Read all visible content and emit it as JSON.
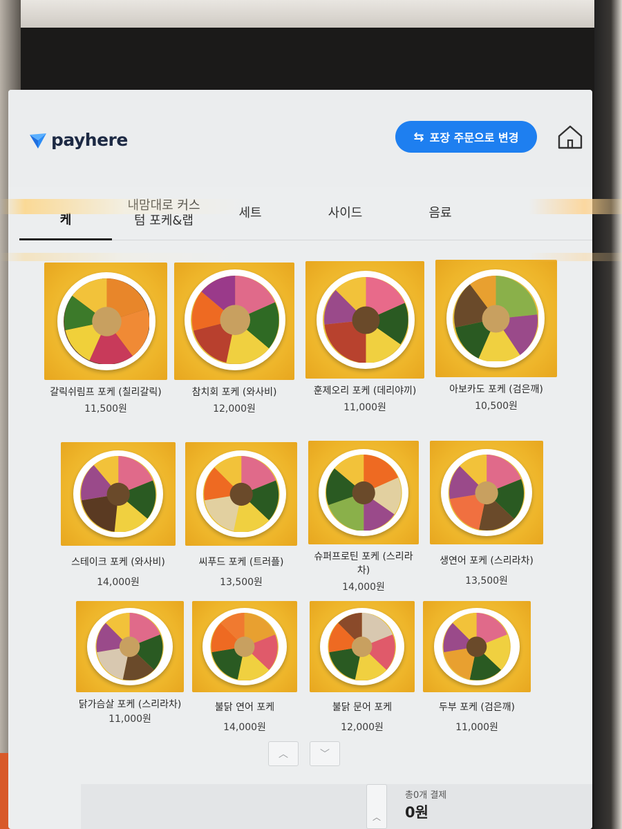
{
  "header": {
    "brand": "payhere",
    "takeout_label": "포장 주문으로 변경"
  },
  "tabs": [
    {
      "label": "케",
      "active": true
    },
    {
      "label": "내맘대로 커스텀 포케&랩",
      "active": false
    },
    {
      "label": "세트",
      "active": false
    },
    {
      "label": "사이드",
      "active": false
    },
    {
      "label": "음료",
      "active": false
    }
  ],
  "menu": [
    {
      "name": "갈릭쉬림프 포케 (칠리갈릭)",
      "price": "11,500원"
    },
    {
      "name": "참치회 포케 (와사비)",
      "price": "12,000원"
    },
    {
      "name": "훈제오리 포케 (데리야끼)",
      "price": "11,000원"
    },
    {
      "name": "아보카도 포케 (검은깨)",
      "price": "10,500원"
    },
    {
      "name": "스테이크 포케 (와사비)",
      "price": "14,000원"
    },
    {
      "name": "씨푸드 포케 (트러플)",
      "price": "13,500원"
    },
    {
      "name": "슈퍼프로틴 포케 (스리라차)",
      "price": "14,000원"
    },
    {
      "name": "생연어 포케 (스리라차)",
      "price": "13,500원"
    },
    {
      "name": "닭가슴살 포케 (스리라차)",
      "price": "11,000원"
    },
    {
      "name": "불닭 연어 포케",
      "price": "14,000원"
    },
    {
      "name": "불닭 문어 포케",
      "price": "12,000원"
    },
    {
      "name": "두부 포케 (검은깨)",
      "price": "11,000원"
    }
  ],
  "footer": {
    "summary_label": "총0개 결제",
    "total": "0원"
  },
  "colors": {
    "accent": "#1e7ff0",
    "card_background": "#f0b92c"
  }
}
